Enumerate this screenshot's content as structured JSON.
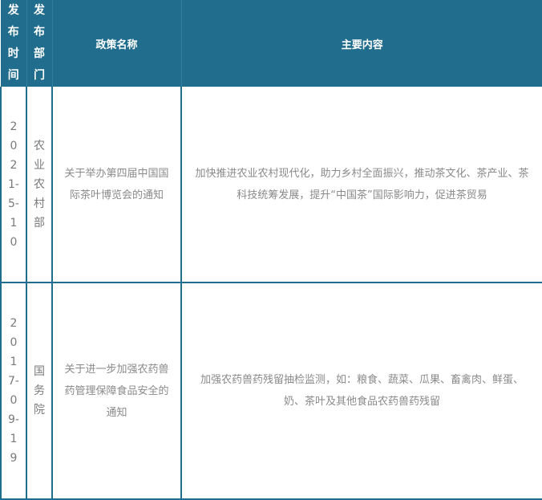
{
  "headers": {
    "date": "发布时间",
    "dept": "发布部门",
    "name": "政策名称",
    "content": "主要内容"
  },
  "rows": [
    {
      "date": "2021-5-10",
      "dept": "农业农村部",
      "name": "关于举办第四届中国国际茶叶博览会的通知",
      "content": "加快推进农业农村现代化，助力乡村全面振兴，推动茶文化、茶产业、茶科技统筹发展，提升“中国茶”国际影响力，促进茶贸易"
    },
    {
      "date": "2017-09-19",
      "dept": "国务院",
      "name": "关于进一步加强农药兽药管理保障食品安全的通知",
      "content": "加强农药兽药残留抽检监测，如：粮食、蔬菜、瓜果、畜禽肉、鲜蛋、奶、茶叶及其他食品农药兽药残留"
    }
  ]
}
